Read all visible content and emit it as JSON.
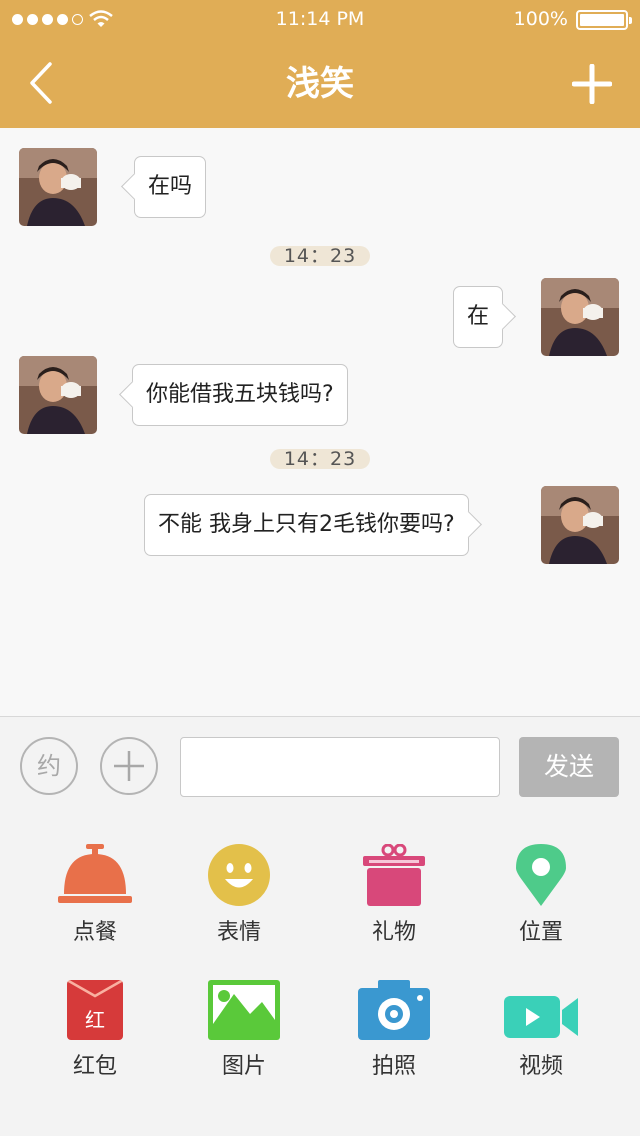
{
  "status_bar": {
    "time": "11:14 PM",
    "battery": "100%"
  },
  "header": {
    "title": "浅笑"
  },
  "messages": [
    {
      "side": "left",
      "text": "在吗"
    },
    {
      "timestamp": "14：23"
    },
    {
      "side": "right",
      "text": "在"
    },
    {
      "side": "left",
      "text": "你能借我五块钱吗?"
    },
    {
      "timestamp": "14：23"
    },
    {
      "side": "right",
      "text": "不能 我身上只有2毛钱你要吗?"
    }
  ],
  "input_bar": {
    "yue_label": "约",
    "text_value": "",
    "send_label": "发送"
  },
  "tools": [
    {
      "label": "点餐",
      "icon": "dining-cloche-icon",
      "color": "#e8704a"
    },
    {
      "label": "表情",
      "icon": "smiley-face-icon",
      "color": "#e3c04a"
    },
    {
      "label": "礼物",
      "icon": "gift-box-icon",
      "color": "#d8487a"
    },
    {
      "label": "位置",
      "icon": "location-pin-icon",
      "color": "#4ecb8a"
    },
    {
      "label": "红包",
      "icon": "red-envelope-icon",
      "color": "#d63a3a",
      "glyph": "红"
    },
    {
      "label": "图片",
      "icon": "picture-icon",
      "color": "#5ac93a"
    },
    {
      "label": "拍照",
      "icon": "camera-icon",
      "color": "#3a98d0"
    },
    {
      "label": "视频",
      "icon": "video-camera-icon",
      "color": "#3ad0b8"
    }
  ],
  "colors": {
    "header": "#e0ad56",
    "send_button": "#b4b4b4",
    "timestamp_bg": "#efe6d6"
  }
}
